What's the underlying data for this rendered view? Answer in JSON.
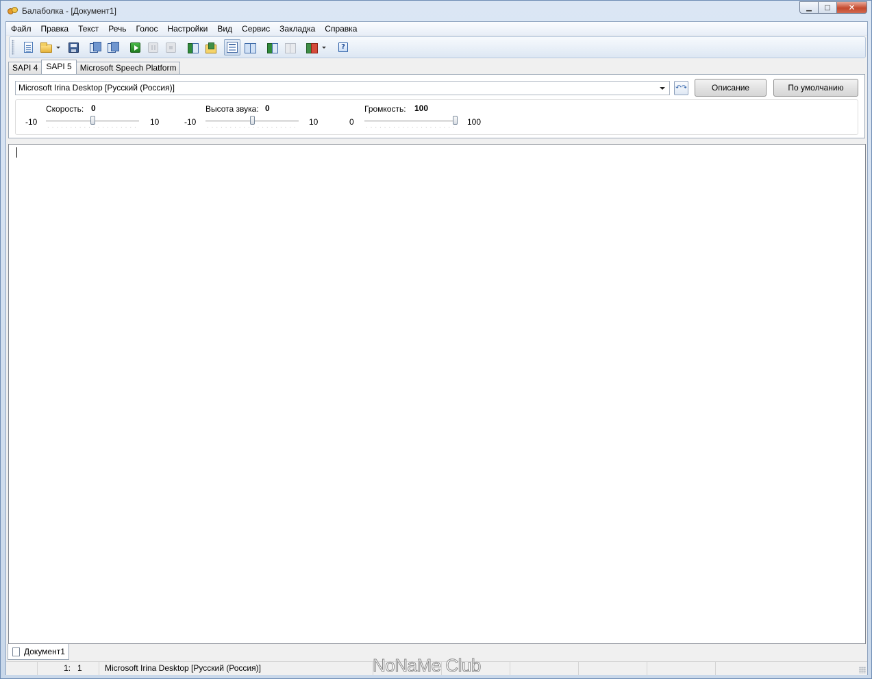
{
  "window": {
    "title": "Балаболка - [Документ1]",
    "controls": {
      "minimize": "▁",
      "maximize": "□",
      "close": "✕"
    }
  },
  "menu": [
    "Файл",
    "Правка",
    "Текст",
    "Речь",
    "Голос",
    "Настройки",
    "Вид",
    "Сервис",
    "Закладка",
    "Справка"
  ],
  "toolbar": {
    "icons": [
      "new-document-icon",
      "open-folder-icon",
      "save-icon",
      "save-audio-icon",
      "batch-save-icon",
      "play-icon",
      "pause-icon",
      "stop-icon",
      "read-clipboard-icon",
      "read-file-icon",
      "clipboard-view-icon",
      "spell-check-icon",
      "compare-icon",
      "disabled-compare-icon",
      "voice-mix-icon",
      "help-icon"
    ],
    "help_glyph": "?"
  },
  "tabs": {
    "items": [
      "SAPI 4",
      "SAPI 5",
      "Microsoft Speech Platform"
    ],
    "active": "SAPI 5"
  },
  "voice": {
    "selected": "Microsoft Irina Desktop [Русский (Россия)]",
    "refresh_glyph": "↶↷",
    "description_button": "Описание",
    "default_button": "По умолчанию"
  },
  "sliders": {
    "speed": {
      "label": "Скорость:",
      "value": "0",
      "min": "-10",
      "max": "10",
      "level": 0.5
    },
    "pitch": {
      "label": "Высота звука:",
      "value": "0",
      "min": "-10",
      "max": "10",
      "level": 0.5
    },
    "volume": {
      "label": "Громкость:",
      "value": "100",
      "min": "0",
      "max": "100",
      "level": 1.0
    }
  },
  "editor": {
    "text": ""
  },
  "documents": {
    "tabs": [
      "Документ1"
    ]
  },
  "status": {
    "line": "1:",
    "col": "1",
    "voice": "Microsoft Irina Desktop [Русский (Россия)]"
  },
  "watermark": "NoNaMe Club"
}
